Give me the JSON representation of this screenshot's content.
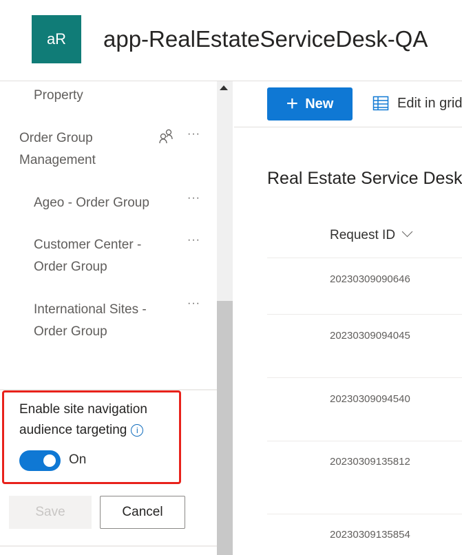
{
  "header": {
    "logo_text": "aR",
    "site_title": "app-RealEstateServiceDesk-QA"
  },
  "sidebar": {
    "items": [
      {
        "label": "Property"
      },
      {
        "label_line1": "Order Group",
        "label_line2": "Management",
        "audience_icon": "people-icon"
      },
      {
        "label": "Ageo - Order Group"
      },
      {
        "label_line1": "Customer Center -",
        "label_line2": "Order Group"
      },
      {
        "label_line1": "International Sites -",
        "label_line2": "Order Group"
      }
    ],
    "more_label": "···",
    "audience_targeting": {
      "label": "Enable site navigation audience targeting",
      "enabled": true,
      "state_label": "On"
    },
    "save_label": "Save",
    "cancel_label": "Cancel"
  },
  "toolbar": {
    "new_label": "New",
    "edit_grid_label": "Edit in grid"
  },
  "list": {
    "title": "Real Estate Service Desk",
    "column_header": "Request ID",
    "rows": [
      "20230309090646",
      "20230309094045",
      "20230309094540",
      "20230309135812",
      "20230309135854"
    ]
  },
  "colors": {
    "accent": "#0f78d4",
    "logo": "#107c77",
    "highlight": "#e8221b"
  }
}
